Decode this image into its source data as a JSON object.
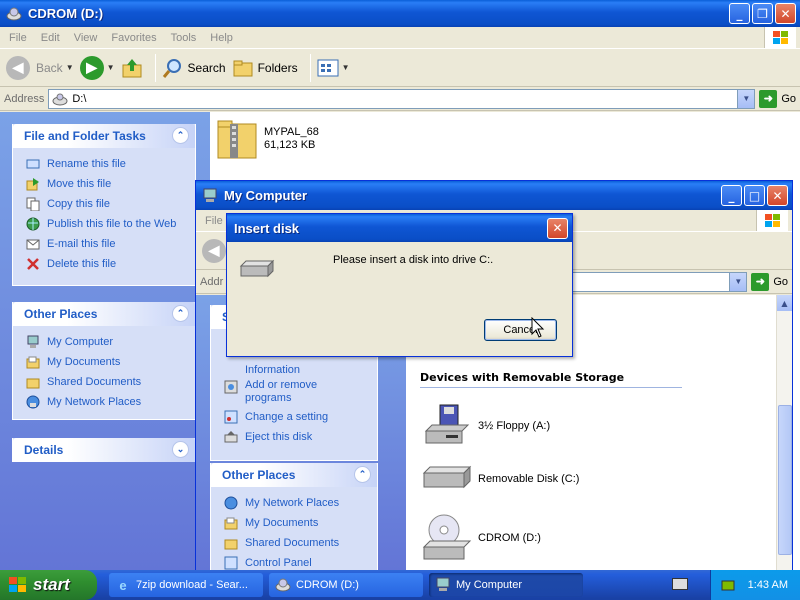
{
  "cdrom_window": {
    "title": "CDROM (D:)",
    "menu": [
      "File",
      "Edit",
      "View",
      "Favorites",
      "Tools",
      "Help"
    ],
    "toolbar": {
      "back": "Back",
      "search": "Search",
      "folders": "Folders"
    },
    "address_label": "Address",
    "address_value": "D:\\",
    "go": "Go",
    "file": {
      "name": "MYPAL_68",
      "size": "61,123 KB"
    },
    "tasks_panel": {
      "title": "File and Folder Tasks",
      "items": [
        "Rename this file",
        "Move this file",
        "Copy this file",
        "Publish this file to the Web",
        "E-mail this file",
        "Delete this file"
      ]
    },
    "other_places": {
      "title": "Other Places",
      "items": [
        "My Computer",
        "My Documents",
        "Shared Documents",
        "My Network Places"
      ]
    },
    "details": {
      "title": "Details"
    }
  },
  "mycomputer_window": {
    "title": "My Computer",
    "menu_first": "File",
    "address_partial": "Addr",
    "go": "Go",
    "system_tasks_items": [
      "Information",
      "Add or remove programs",
      "Change a setting",
      "Eject this disk"
    ],
    "system_tasks_partial": "S",
    "other_places": {
      "title": "Other Places",
      "items": [
        "My Network Places",
        "My Documents",
        "Shared Documents",
        "Control Panel"
      ]
    },
    "devices_header": "Devices with Removable Storage",
    "devices": [
      "3½ Floppy (A:)",
      "Removable Disk (C:)",
      "CDROM (D:)"
    ]
  },
  "dialog": {
    "title": "Insert disk",
    "message": "Please insert a disk into drive C:.",
    "cancel": "Cancel"
  },
  "taskbar": {
    "start": "start",
    "tasks": [
      "7zip download - Sear...",
      "CDROM (D:)",
      "My Computer"
    ],
    "time": "1:43 AM"
  }
}
